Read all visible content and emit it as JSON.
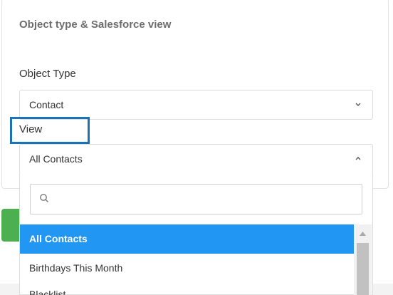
{
  "card": {
    "title": "Object type & Salesforce view"
  },
  "object_type": {
    "label": "Object Type",
    "value": "Contact"
  },
  "view": {
    "label": "View",
    "value": "All Contacts"
  },
  "search": {
    "placeholder": ""
  },
  "list": {
    "items": [
      "All Contacts",
      "Birthdays This Month",
      "Blacklist"
    ],
    "selected": "All Contacts"
  },
  "colors": {
    "selected": "#2196f3",
    "highlight_border": "#1a73b6",
    "green_button": "#4caf50"
  },
  "icons": {
    "select_chevron": "chevron-down-icon",
    "view_chevron": "chevron-up-icon",
    "search": "search-icon"
  }
}
